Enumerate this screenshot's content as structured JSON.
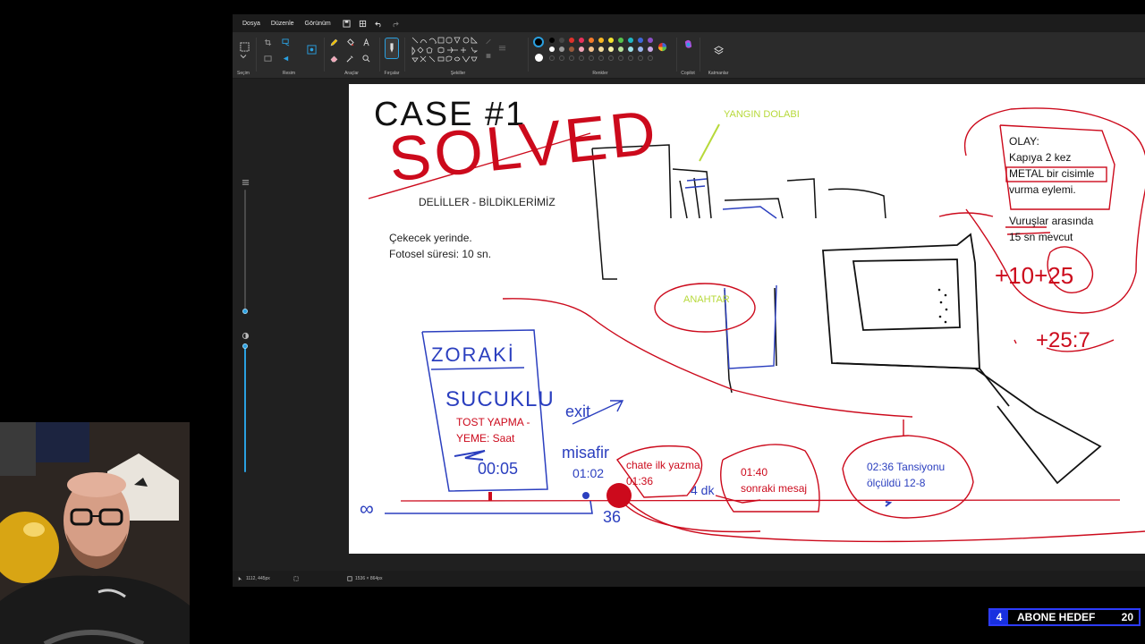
{
  "menu": {
    "file": "Dosya",
    "edit": "Düzenle",
    "view": "Görünüm"
  },
  "ribbon": {
    "selection": "Seçim",
    "image": "Resim",
    "tools": "Araçlar",
    "brushes": "Fırçalar",
    "shapes": "Şekiller",
    "colors": "Renkler",
    "copilot": "Copilot",
    "layers": "Katmanlar"
  },
  "palette": {
    "active_primary": "#000000",
    "active_secondary": "#ffffff",
    "swatches_row1": [
      "#000000",
      "#464646",
      "#e0312b",
      "#e8305a",
      "#f47a2a",
      "#f7b723",
      "#f4e32e",
      "#56c24b",
      "#1fb6c4",
      "#3d66d8",
      "#8b4fc7"
    ],
    "swatches_row2": [
      "#ffffff",
      "#9b9b9b",
      "#9a5a3c",
      "#f2a6b8",
      "#f6c48e",
      "#f3dc9c",
      "#f6f2a6",
      "#b8e39b",
      "#9ee1ea",
      "#9cb6ee",
      "#c8a9e6"
    ]
  },
  "canvas_text": {
    "case": "CASE #1",
    "solved": "SOLVED",
    "evidence": "DELİLLER - BİLDİKLERİMİZ",
    "fact1": "Çekecek yerinde.",
    "fact2": "Fotosel süresi: 10 sn.",
    "fire_cabinet": "YANGIN DOLABI",
    "key": "ANAHTAR",
    "olay_title": "OLAY:",
    "olay_line1": "Kapıya 2 kez",
    "olay_line2": "METAL bir cisimle",
    "olay_line3": "vurma eylemi.",
    "vurus1": "Vuruşlar arasında",
    "vurus2": "15 sn mevcut",
    "calc1": "+10+25",
    "calc2": "+25:7",
    "zoraki": "ZORAKİ",
    "sucuklu": "SUCUKLU",
    "tost1": "TOST YAPMA -",
    "tost2": "YEME: Saat",
    "time_scribble": "00:05",
    "exit_note": "exit",
    "misafir": "misafir",
    "misafir_time": "01:02",
    "chat1": "chate ilk yazma",
    "chat2": "01:36",
    "next1": "01:40",
    "next2": "sonraki mesaj",
    "bp1": "02:36 Tansiyonu",
    "bp2": "ölçüldü 12-8",
    "num36": "36",
    "infinity": "∞",
    "tail_note": "4 dk"
  },
  "status": {
    "cursor": "1112, 445px",
    "size": "1536 × 864px"
  },
  "sub_goal": {
    "current": "4",
    "label": "ABONE HEDEF",
    "target": "20"
  }
}
